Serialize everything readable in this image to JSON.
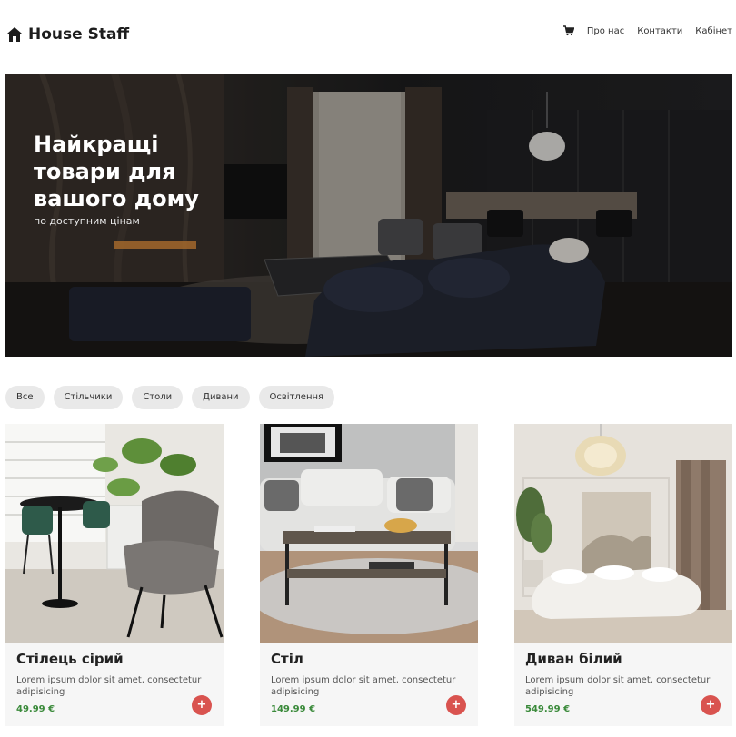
{
  "header": {
    "brand": "House Staff",
    "nav": {
      "about": "Про нас",
      "contacts": "Контакти",
      "account": "Кабінет"
    }
  },
  "hero": {
    "title": "Найкращі товари для вашого дому",
    "subtitle": "по доступним цінам"
  },
  "filters": [
    "Все",
    "Стільчики",
    "Столи",
    "Дивани",
    "Освітлення"
  ],
  "products": [
    {
      "title": "Стілець сірий",
      "description": "Lorem ipsum dolor sit amet, consectetur adipisicing",
      "price": "49.99 €",
      "add_label": "+"
    },
    {
      "title": "Стіл",
      "description": "Lorem ipsum dolor sit amet, consectetur adipisicing",
      "price": "149.99 €",
      "add_label": "+"
    },
    {
      "title": "Диван білий",
      "description": "Lorem ipsum dolor sit amet, consectetur adipisicing",
      "price": "549.99 €",
      "add_label": "+"
    }
  ],
  "colors": {
    "accent_button": "#d9534f",
    "price": "#3a8a3a",
    "chip_bg": "#e9e9e9",
    "card_bg": "#f6f6f6"
  },
  "icons": {
    "logo": "house-icon",
    "cart": "cart-icon",
    "add": "plus-icon"
  }
}
